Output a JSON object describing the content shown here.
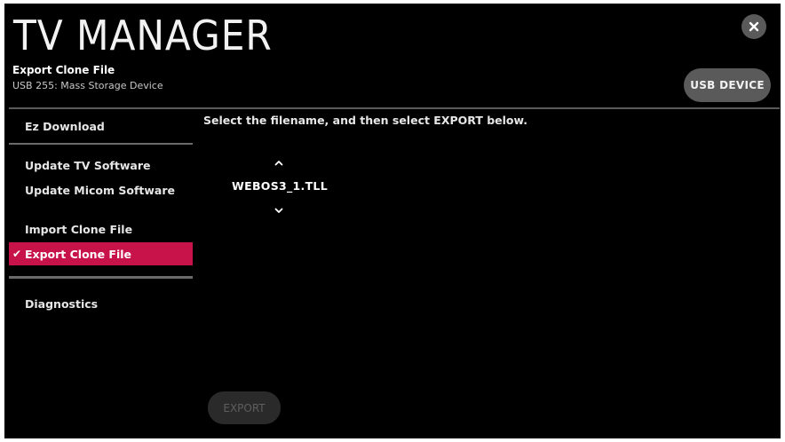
{
  "header": {
    "app_title": "TV MANAGER",
    "page_title": "Export Clone File",
    "device_label": "USB 255: Mass Storage Device",
    "usb_button_label": "USB DEVICE",
    "close_icon": "close-icon"
  },
  "sidebar": {
    "items": [
      {
        "label": "Ez Download",
        "active": false
      },
      {
        "label": "Update TV Software",
        "active": false
      },
      {
        "label": "Update Micom Software",
        "active": false
      },
      {
        "label": "Import Clone File",
        "active": false
      },
      {
        "label": "Export Clone File",
        "active": true
      },
      {
        "label": "Diagnostics",
        "active": false
      }
    ],
    "check_icon": "✔"
  },
  "main": {
    "instruction": "Select the filename, and then select EXPORT below.",
    "filename": "WEBOS3_1.TLL",
    "up_icon": "chevron-up-icon",
    "down_icon": "chevron-down-icon",
    "export_label": "EXPORT",
    "export_enabled": false
  },
  "colors": {
    "background": "#000000",
    "active_item": "#c8124a",
    "button": "#5a5a5a",
    "disabled_button": "#2a2a2a",
    "divider": "#5a5a5a"
  }
}
